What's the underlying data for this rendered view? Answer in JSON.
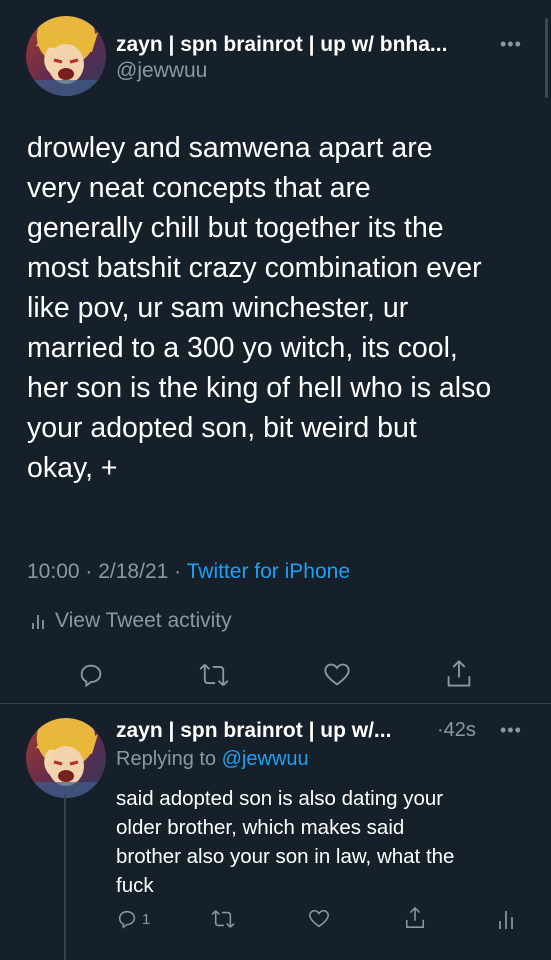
{
  "main_tweet": {
    "author_name": "zayn | spn brainrot | up w/ bnha...",
    "author_handle": "@jewwuu",
    "more_icon": "more-horizontal-icon",
    "text": "drowley and samwena apart are\nvery neat concepts that are\ngenerally chill but together its the\nmost batshit crazy combination ever\nlike pov, ur sam winchester, ur\nmarried to a 300 yo witch, its cool,\nher son is the king of hell who is also\nyour adopted son, bit weird but\nokay, +",
    "time": "10:00",
    "date": "2/18/21",
    "source": "Twitter for iPhone",
    "activity_label": "View Tweet activity",
    "actions": [
      "reply-icon",
      "retweet-icon",
      "like-icon",
      "share-icon"
    ]
  },
  "reply_tweet": {
    "author_name": "zayn | spn brainrot | up w/...",
    "age": "42s",
    "replying_label": "Replying to",
    "replying_handle": "@jewwuu",
    "text": "said adopted son is also dating your\nolder brother, which makes said\nbrother also your son in law, what the\nfuck",
    "reply_count": "1",
    "actions": [
      "reply-icon",
      "retweet-icon",
      "like-icon",
      "share-icon",
      "analytics-icon"
    ]
  },
  "colors": {
    "background": "#15202b",
    "accent": "#1da1f2",
    "secondary_text": "#8899a6",
    "divider": "#38444d"
  }
}
